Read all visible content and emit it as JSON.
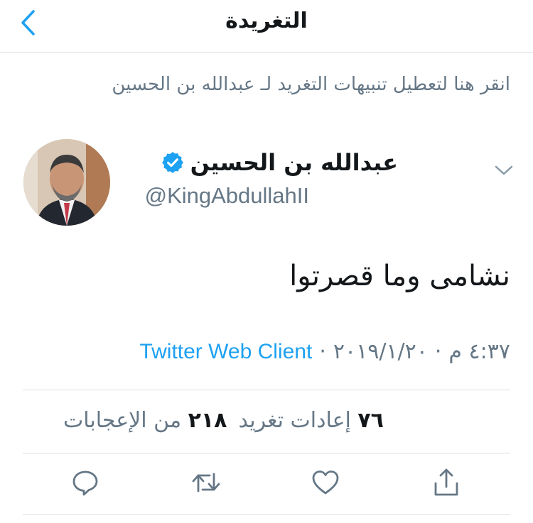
{
  "nav": {
    "title": "التغريدة",
    "back_icon": "chevron-left-icon"
  },
  "notification_banner": "انقر هنا لتعطيل تنبيهات التغريد لـ عبدالله بن الحسين",
  "author": {
    "name": "عبدالله بن الحسين",
    "handle": "@KingAbdullahII",
    "verified": true
  },
  "tweet": {
    "text": "نشامى وما قصرتوا",
    "time": "٤:٣٧ م",
    "date": "٢٠١٩/١/٢٠",
    "separator": "·",
    "client": "Twitter Web Client"
  },
  "stats": {
    "retweets_count": "٧٦",
    "retweets_label": "إعادات تغريد",
    "likes_count": "٢١٨",
    "likes_label": "من الإعجابات"
  },
  "actions": [
    "reply-icon",
    "retweet-icon",
    "like-icon",
    "share-icon"
  ],
  "colors": {
    "accent": "#1da1f2",
    "secondary_text": "#657786",
    "divider": "#d8dde1"
  }
}
